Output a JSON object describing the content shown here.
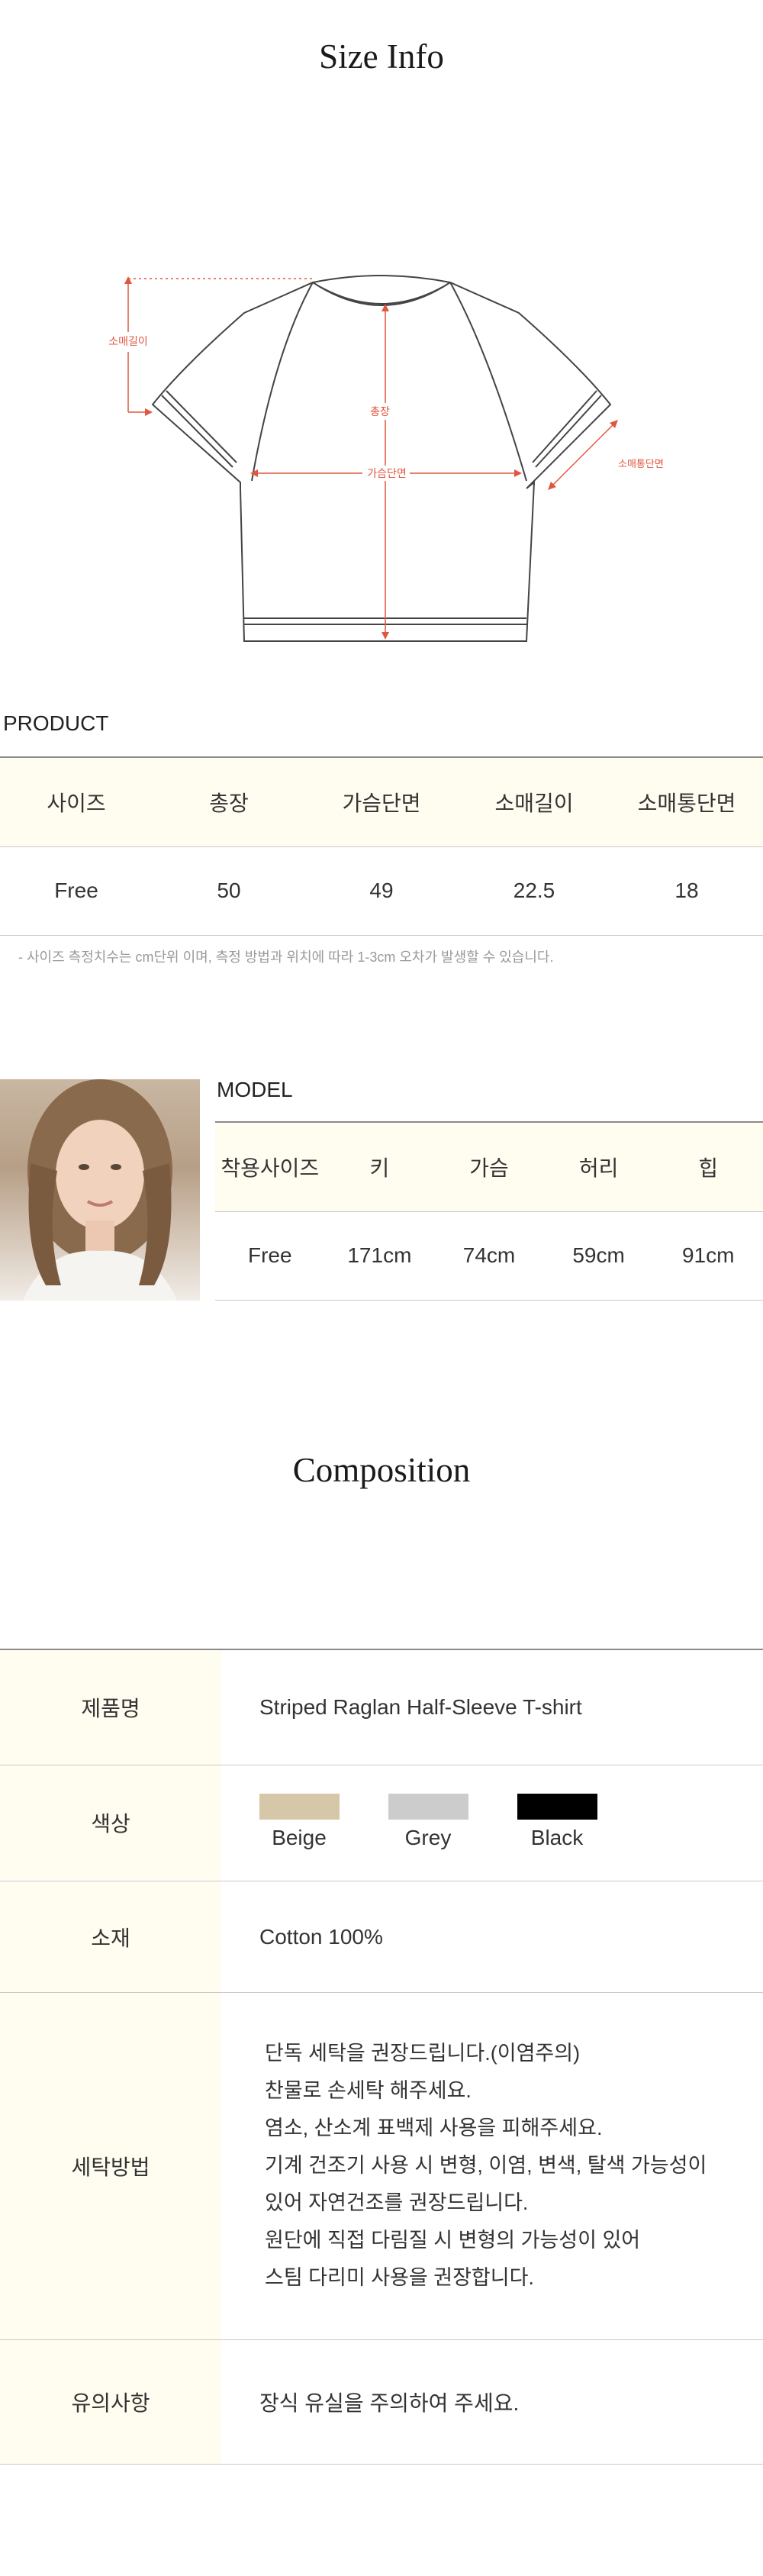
{
  "size_info": {
    "title": "Size Info",
    "diagram_labels": {
      "sleeve_length": "소매길이",
      "chest": "가슴단면",
      "sleeve_width": "소매통단면",
      "total_length": "총장"
    }
  },
  "product": {
    "label": "PRODUCT",
    "headers": [
      "사이즈",
      "총장",
      "가슴단면",
      "소매길이",
      "소매통단면"
    ],
    "rows": [
      [
        "Free",
        "50",
        "49",
        "22.5",
        "18"
      ]
    ],
    "note": "-  사이즈 측정치수는 cm단위 이며, 측정 방법과 위치에 따라 1-3cm 오차가 발생할 수 있습니다."
  },
  "model": {
    "label": "MODEL",
    "headers": [
      "착용사이즈",
      "키",
      "가슴",
      "허리",
      "힙"
    ],
    "rows": [
      [
        "Free",
        "171cm",
        "74cm",
        "59cm",
        "91cm"
      ]
    ]
  },
  "composition": {
    "title": "Composition",
    "product_name_label": "제품명",
    "product_name": "Striped Raglan Half-Sleeve T-shirt",
    "color_label": "색상",
    "colors": [
      {
        "name": "Beige",
        "hex": "#d6c7a8"
      },
      {
        "name": "Grey",
        "hex": "#cccccc"
      },
      {
        "name": "Black",
        "hex": "#000000"
      }
    ],
    "material_label": "소재",
    "material": "Cotton 100%",
    "care_label": "세탁방법",
    "care_lines": [
      "단독 세탁을 권장드립니다.(이염주의)",
      "찬물로 손세탁 해주세요.",
      "염소, 산소계 표백제 사용을 피해주세요.",
      "기계 건조기 사용 시 변형, 이염, 변색, 탈색 가능성이",
      "있어 자연건조를 권장드립니다.",
      "원단에 직접 다림질 시 변형의 가능성이 있어",
      "스팀 다리미 사용을 권장합니다."
    ],
    "caution_label": "유의사항",
    "caution": "장식 유실을 주의하여 주세요."
  },
  "colors": {
    "accent_red": "#e0573f",
    "header_bg": "#fffcf0"
  }
}
